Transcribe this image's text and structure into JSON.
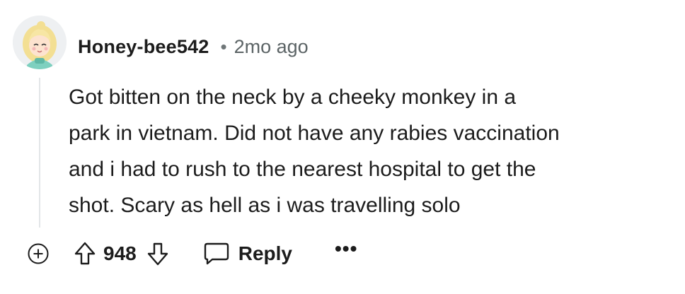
{
  "comment": {
    "username": "Honey-bee542",
    "separator": "•",
    "timestamp": "2mo ago",
    "body_lines": [
      "Got bitten on the neck by a cheeky monkey in a",
      "park in vietnam. Did not have any rabies vaccination",
      "and i had to rush to the nearest hospital to get the",
      "shot. Scary as hell as i was travelling solo"
    ],
    "avatar_icon": "avatar-icon"
  },
  "actions": {
    "expand_icon": "plus-circle-icon",
    "upvote_icon": "arrow-up-icon",
    "score": "948",
    "downvote_icon": "arrow-down-icon",
    "reply_icon": "speech-bubble-icon",
    "reply_label": "Reply",
    "more_label": "•••"
  },
  "colors": {
    "text": "#1c1c1c",
    "meta": "#5c6466",
    "thread_line": "#e3e6e8"
  }
}
